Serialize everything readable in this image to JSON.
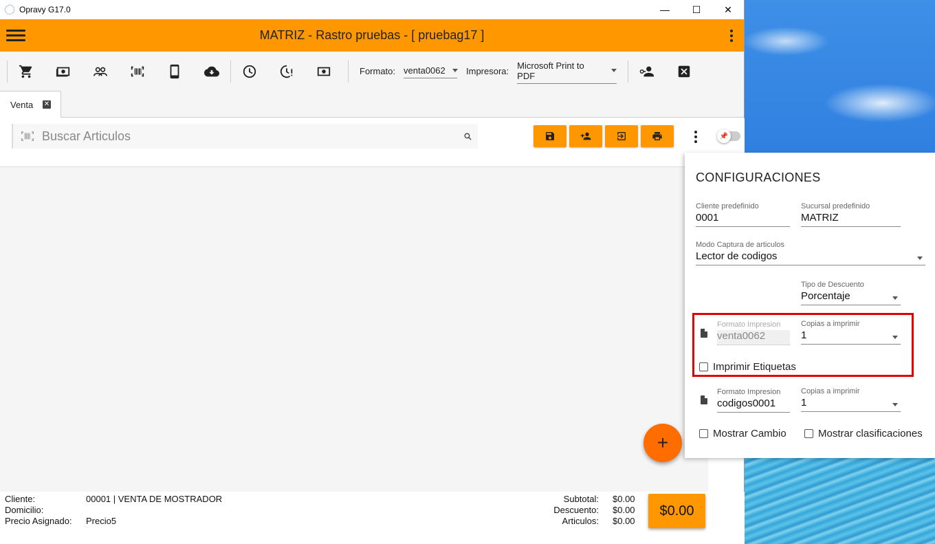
{
  "window": {
    "title": "Opravy G17.0",
    "minimize": "—",
    "maximize": "☐",
    "close": "✕"
  },
  "appbar": {
    "title": "MATRIZ - Rastro pruebas - [ pruebag17 ]"
  },
  "toolbar": {
    "icons": [
      "cart-icon",
      "cash-icon",
      "users-icon",
      "barcode-icon",
      "tablet-icon",
      "cloud-sync-icon",
      "clock-icon",
      "clock-alert-icon",
      "money-icon",
      "assign-user-icon",
      "close-box-icon"
    ],
    "formato_label": "Formato:",
    "formato_value": "venta0062",
    "impresora_label": "Impresora:",
    "impresora_value": "Microsoft Print to PDF"
  },
  "tabs": [
    {
      "label": "Venta"
    }
  ],
  "search": {
    "placeholder": "Buscar Articulos"
  },
  "config": {
    "title": "CONFIGURACIONES",
    "cliente_label": "Cliente predefinido",
    "cliente_value": "0001",
    "sucursal_label": "Sucursal predefinido",
    "sucursal_value": "MATRIZ",
    "modo_label": "Modo Captura de articulos",
    "modo_value": "Lector de codigos",
    "descuento_label": "Tipo de Descuento",
    "descuento_value": "Porcentaje",
    "formato1_label": "Formato Impresion",
    "formato1_value": "venta0062",
    "copias1_label": "Copias a imprimir",
    "copias1_value": "1",
    "etiquetas_label": "Imprimir Etiquetas",
    "formato2_label": "Formato Impresion",
    "formato2_value": "codigos0001",
    "copias2_label": "Copias a imprimir",
    "copias2_value": "1",
    "cambio_label": "Mostrar Cambio",
    "clasif_label": "Mostrar clasificaciones"
  },
  "footer": {
    "cliente_label": "Cliente:",
    "cliente_value": "00001 | VENTA DE MOSTRADOR",
    "domicilio_label": "Domicilio:",
    "domicilio_value": "",
    "precio_label": "Precio Asignado:",
    "precio_value": "Precio5",
    "subtotal_label": "Subtotal:",
    "subtotal_value": "$0.00",
    "descuento_label": "Descuento:",
    "descuento_value": "$0.00",
    "articulos_label": "Articulos:",
    "articulos_value": "$0.00",
    "total": "$0.00"
  },
  "fab": {
    "label": "+"
  },
  "colors": {
    "primary": "#ff9800",
    "fab": "#ff6d00",
    "highlight": "#e00000"
  }
}
